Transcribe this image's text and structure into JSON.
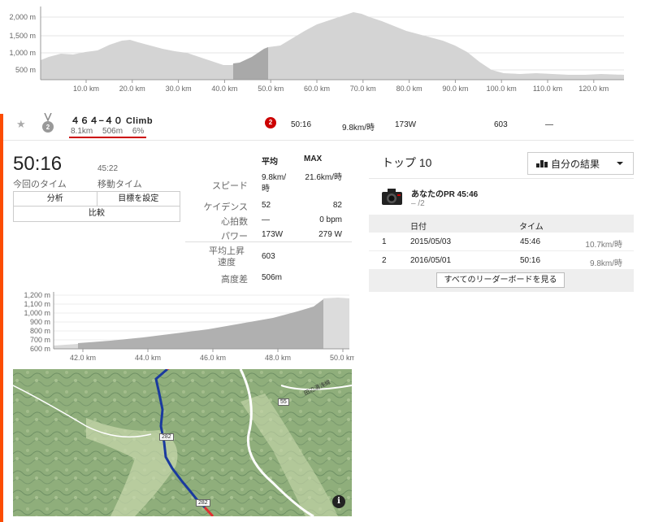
{
  "top_chart": {
    "y_ticks": [
      "2,000 m",
      "1,500 m",
      "1,000 m",
      "500 m"
    ],
    "x_ticks": [
      "10.0 km",
      "20.0 km",
      "30.0 km",
      "40.0 km",
      "50.0 km",
      "60.0 km",
      "70.0 km",
      "80.0 km",
      "90.0 km",
      "100.0 km",
      "110.0 km",
      "120.0 km"
    ]
  },
  "segment": {
    "name": "４６４−４０ Climb",
    "distance": "8.1km",
    "elevation": "506m",
    "grade": "6%",
    "rank": "2",
    "time": "50:16",
    "speed": "9.8km/時",
    "power": "173W",
    "vam": "603",
    "hr": "—"
  },
  "stats": {
    "elapsed_time": "50:16",
    "elapsed_label": "今回のタイム",
    "moving_time": "45:22",
    "moving_label": "移動タイム",
    "avg_header": "平均",
    "max_header": "MAX",
    "rows": [
      {
        "label": "スピード",
        "avg": "9.8km/時",
        "max": "21.6km/時"
      },
      {
        "label": "ケイデンス",
        "avg": "52",
        "max": "82"
      },
      {
        "label": "心拍数",
        "avg": "—",
        "max": "0 bpm"
      },
      {
        "label": "パワー",
        "avg": "173W",
        "max": "279 W"
      }
    ],
    "vam_label": "平均上昇速度",
    "vam_value": "603",
    "elev_label": "高度差",
    "elev_value": "506m"
  },
  "buttons": {
    "analysis": "分析",
    "set_goal": "目標を設定",
    "compare": "比較"
  },
  "detail_chart": {
    "y_ticks": [
      "1,200 m",
      "1,100 m",
      "1,000 m",
      "900 m",
      "800 m",
      "700 m",
      "600 m"
    ],
    "x_ticks": [
      "42.0 km",
      "44.0 km",
      "46.0 km",
      "48.0 km",
      "50.0 km"
    ]
  },
  "map": {
    "road_labels": [
      "55",
      "282",
      "282"
    ],
    "place_label": "田辺湯浅線",
    "info_glyph": "i"
  },
  "leaderboard": {
    "title": "トップ 10",
    "filter": "自分の結果",
    "pr_title": "あなたのPR 45:46",
    "pr_sub": "– /2",
    "col_date": "日付",
    "col_time": "タイム",
    "rows": [
      {
        "rank": "1",
        "date": "2015/05/03",
        "time": "45:46",
        "speed": "10.7km/時"
      },
      {
        "rank": "2",
        "date": "2016/05/01",
        "time": "50:16",
        "speed": "9.8km/時"
      }
    ],
    "view_all": "すべてのリーダーボードを見る"
  },
  "colors": {
    "accent": "#fc4c02",
    "medal_rank": "#cc0000",
    "route": "#1a3a9e",
    "route_end": "#e03030"
  }
}
